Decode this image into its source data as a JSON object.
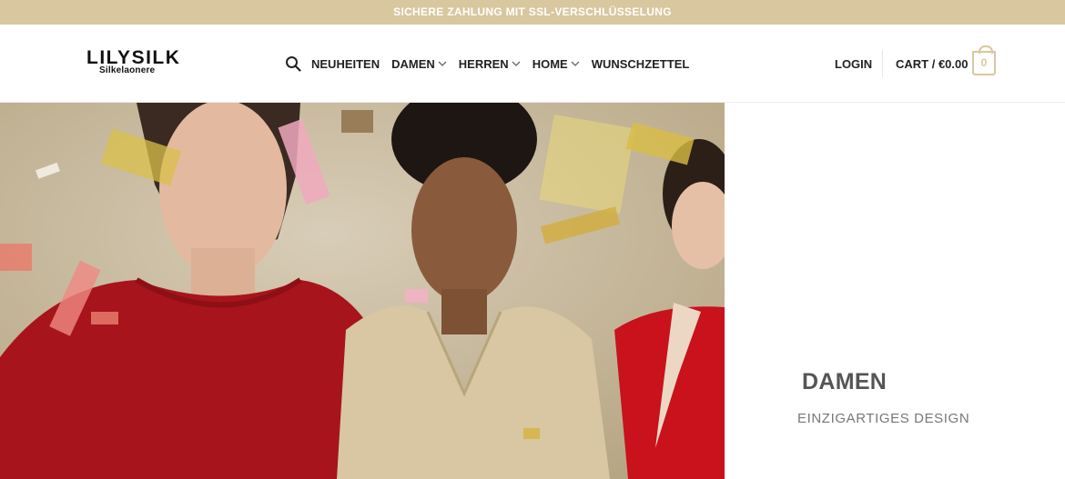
{
  "top_banner": {
    "text": "SICHERE ZAHLUNG MIT SSL-VERSCHLÜSSELUNG"
  },
  "logo": {
    "main": "LILYSILK",
    "sub": "Silkelaonere"
  },
  "nav": {
    "items": [
      {
        "label": "NEUHEITEN",
        "has_dropdown": false
      },
      {
        "label": "DAMEN",
        "has_dropdown": true
      },
      {
        "label": "HERREN",
        "has_dropdown": true
      },
      {
        "label": "HOME",
        "has_dropdown": true
      },
      {
        "label": "WUNSCHZETTEL",
        "has_dropdown": false
      }
    ]
  },
  "account": {
    "login_label": "LOGIN"
  },
  "cart": {
    "label": "CART / €0.00",
    "count": "0"
  },
  "hero_panel": {
    "title": "DAMEN",
    "subtitle": "EINZIGARTIGES DESIGN"
  },
  "colors": {
    "accent": "#d9c79f",
    "text": "#222222"
  },
  "icons": [
    "search-icon",
    "chevron-down-icon",
    "cart-bag-icon"
  ]
}
